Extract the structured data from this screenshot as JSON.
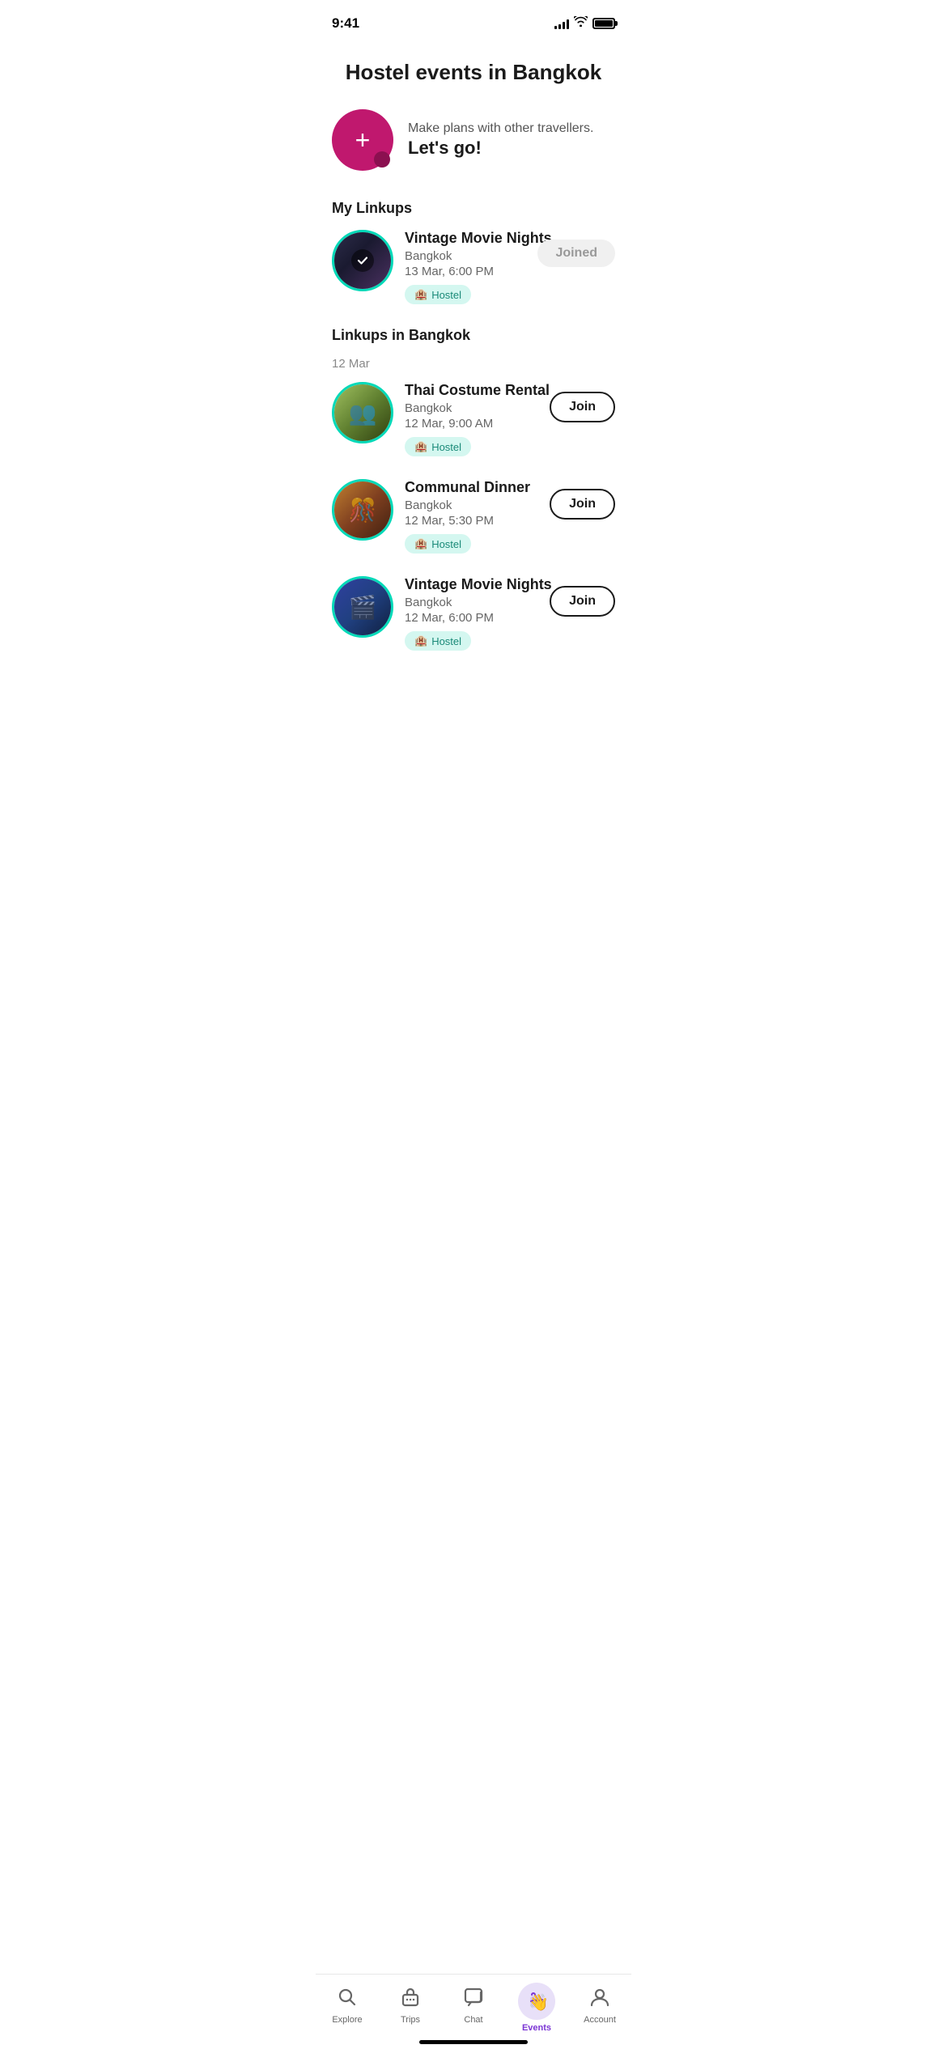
{
  "statusBar": {
    "time": "9:41",
    "signalBars": [
      4,
      6,
      8,
      11,
      14
    ],
    "hasWifi": true,
    "hasBattery": true
  },
  "header": {
    "title": "Hostel events in Bangkok"
  },
  "createBanner": {
    "subtitle": "Make plans with other travellers.",
    "cta": "Let's go!",
    "plusLabel": "+"
  },
  "myLinkups": {
    "sectionTitle": "My Linkups",
    "items": [
      {
        "id": "vintage-joined",
        "name": "Vintage Movie Nights",
        "location": "Bangkok",
        "datetime": "13 Mar, 6:00 PM",
        "badge": "Hostel",
        "action": "Joined",
        "actionType": "joined"
      }
    ]
  },
  "linkupsInBangkok": {
    "sectionTitle": "Linkups in Bangkok",
    "dateGroups": [
      {
        "date": "12 Mar",
        "items": [
          {
            "id": "thai-costume",
            "name": "Thai Costume Rental",
            "location": "Bangkok",
            "datetime": "12 Mar, 9:00 AM",
            "badge": "Hostel",
            "action": "Join",
            "actionType": "join"
          },
          {
            "id": "communal-dinner",
            "name": "Communal Dinner",
            "location": "Bangkok",
            "datetime": "12 Mar, 5:30 PM",
            "badge": "Hostel",
            "action": "Join",
            "actionType": "join"
          },
          {
            "id": "vintage-2",
            "name": "Vintage Movie Nights",
            "location": "Bangkok",
            "datetime": "12 Mar, 6:00 PM",
            "badge": "Hostel",
            "action": "Join",
            "actionType": "join"
          }
        ]
      }
    ]
  },
  "bottomNav": {
    "items": [
      {
        "id": "explore",
        "label": "Explore",
        "icon": "search",
        "active": false
      },
      {
        "id": "trips",
        "label": "Trips",
        "icon": "trips",
        "active": false
      },
      {
        "id": "chat",
        "label": "Chat",
        "icon": "chat",
        "active": false
      },
      {
        "id": "events",
        "label": "Events",
        "icon": "events",
        "active": true
      },
      {
        "id": "account",
        "label": "Account",
        "icon": "account",
        "active": false
      }
    ]
  }
}
